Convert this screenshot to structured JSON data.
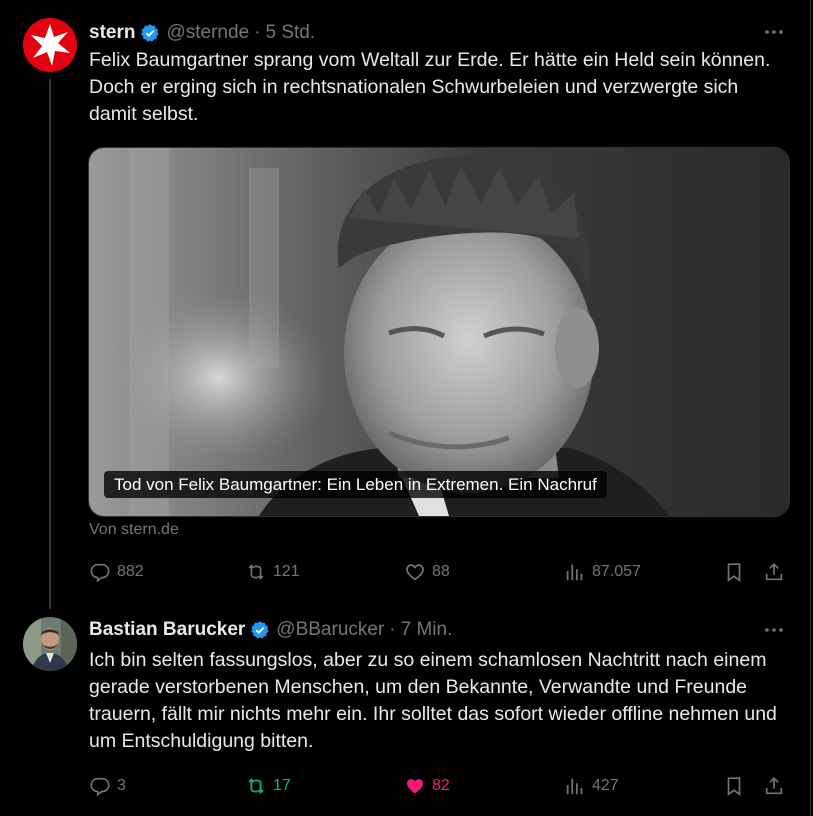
{
  "tweets": [
    {
      "author": "stern",
      "handle": "@sternde",
      "separator": "·",
      "time": "5 Std.",
      "text": "Felix Baumgartner sprang vom Weltall zur Erde. Er hätte ein Held sein können. Doch er erging sich in rechtsnationalen Schwurbeleien und verzwergte sich damit selbst.",
      "card": {
        "title": "Tod von Felix Baumgartner: Ein Leben in Extremen. Ein Nachruf",
        "source": "Von stern.de"
      },
      "stats": {
        "replies": "882",
        "reposts": "121",
        "likes": "88",
        "views": "87.057"
      }
    },
    {
      "author": "Bastian Barucker",
      "handle": "@BBarucker",
      "separator": "·",
      "time": "7 Min.",
      "text": "Ich bin selten fassungslos, aber zu so einem schamlosen Nachtritt nach einem gerade verstorbenen Menschen, um den Bekannte, Verwandte und Freunde  trauern, fällt mir nichts mehr ein. Ihr solltet das sofort wieder offline nehmen und um Entschuldigung bitten.",
      "stats": {
        "replies": "3",
        "reposts": "17",
        "likes": "82",
        "views": "427"
      }
    }
  ],
  "colors": {
    "background": "#000000",
    "text": "#e7e9ea",
    "muted": "#71767b",
    "verified": "#1d9bf0",
    "repost_active": "#00ba7c",
    "like_active": "#f91880",
    "stern_red": "#e3000f"
  }
}
